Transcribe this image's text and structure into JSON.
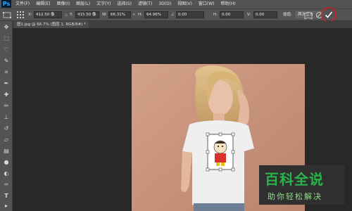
{
  "app": {
    "logo": "Ps"
  },
  "menu": [
    "文件(F)",
    "编辑(E)",
    "图像(I)",
    "图层(L)",
    "文字(Y)",
    "选择(S)",
    "滤镜(T)",
    "3D(D)",
    "视图(V)",
    "窗口(W)",
    "帮助(H)"
  ],
  "options": {
    "x_label": "X:",
    "x_value": "412.50 像",
    "y_label": "Y:",
    "y_value": "415.50 像",
    "w_label": "W:",
    "w_value": "66.31%",
    "h_label": "H:",
    "h_value": "64.96%",
    "angle_value": "0.00",
    "hskew_label": "H:",
    "hskew_value": "0.00",
    "vskew_label": "V:",
    "vskew_value": "0.00",
    "interp_label": "插值:",
    "interp_value": "两次立方"
  },
  "document": {
    "tab_title": "图1.jpg @ 66.7% (图层 1, RGB/8#) *"
  },
  "watermark": {
    "title": "百科全说",
    "subtitle": "助你轻松解决"
  },
  "colors": {
    "commit_circle": "#d21f1f",
    "photo_bg": "#c9937c"
  }
}
